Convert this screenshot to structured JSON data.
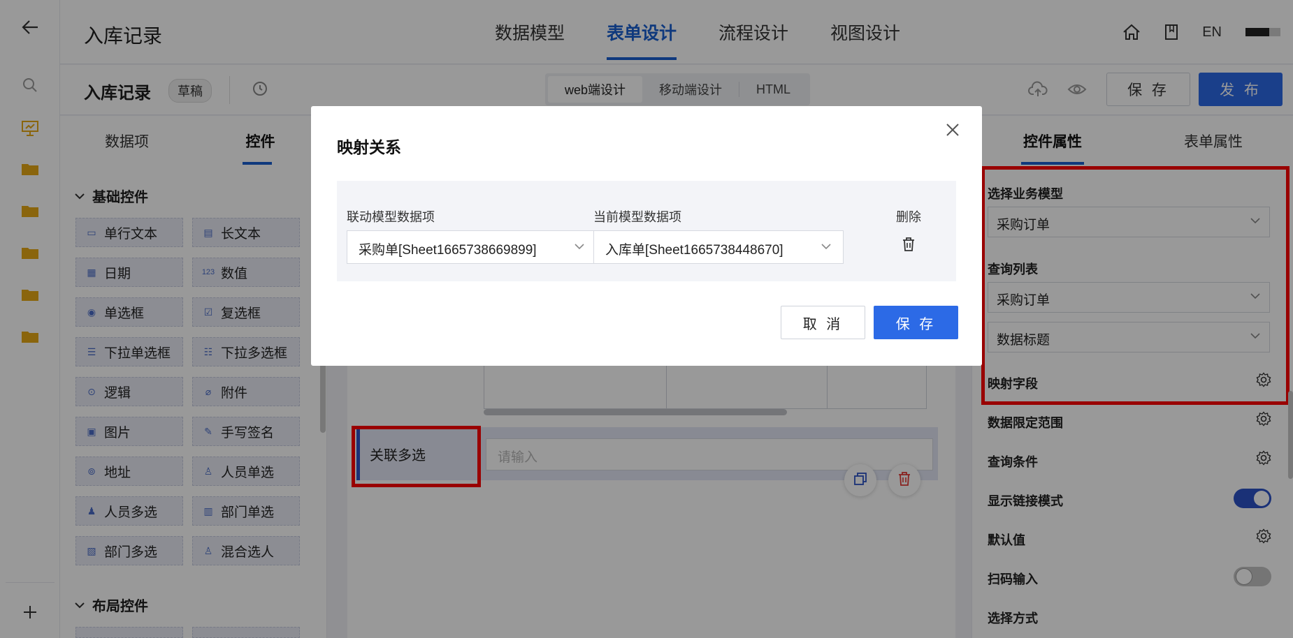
{
  "app": {
    "title": "入库记录"
  },
  "nav": {
    "tabs": [
      {
        "label": "数据模型"
      },
      {
        "label": "表单设计"
      },
      {
        "label": "流程设计"
      },
      {
        "label": "视图设计"
      }
    ],
    "active": 1
  },
  "topbar": {
    "lang": "EN"
  },
  "subbar": {
    "form_title": "入库记录",
    "status_badge": "草稿",
    "modes": [
      "web端设计",
      "移动端设计",
      "HTML"
    ],
    "save_label": "保 存",
    "publish_label": "发 布"
  },
  "left_panel": {
    "tabs": [
      "数据项",
      "控件"
    ],
    "basic_section": "基础控件",
    "basic_controls": [
      {
        "label": "单行文本",
        "icon": "text-line-icon"
      },
      {
        "label": "长文本",
        "icon": "textarea-icon"
      },
      {
        "label": "日期",
        "icon": "calendar-icon"
      },
      {
        "label": "数值",
        "icon": "number-icon"
      },
      {
        "label": "单选框",
        "icon": "radio-icon"
      },
      {
        "label": "复选框",
        "icon": "checkbox-icon"
      },
      {
        "label": "下拉单选框",
        "icon": "list-icon"
      },
      {
        "label": "下拉多选框",
        "icon": "checklist-icon"
      },
      {
        "label": "逻辑",
        "icon": "toggle-icon"
      },
      {
        "label": "附件",
        "icon": "paperclip-icon"
      },
      {
        "label": "图片",
        "icon": "image-icon"
      },
      {
        "label": "手写签名",
        "icon": "pen-icon"
      },
      {
        "label": "地址",
        "icon": "location-pin-icon"
      },
      {
        "label": "人员单选",
        "icon": "user-icon"
      },
      {
        "label": "人员多选",
        "icon": "users-icon"
      },
      {
        "label": "部门单选",
        "icon": "department-icon"
      },
      {
        "label": "部门多选",
        "icon": "departments-icon"
      },
      {
        "label": "混合选人",
        "icon": "user-mixed-icon"
      }
    ],
    "layout_section": "布局控件"
  },
  "canvas": {
    "field_label": "关联多选",
    "field_placeholder": "请输入"
  },
  "right_panel": {
    "tabs": [
      "控件属性",
      "表单属性"
    ],
    "business_model_label": "选择业务模型",
    "business_model_value": "采购订单",
    "query_list_label": "查询列表",
    "query_list_value": "采购订单",
    "data_title_value": "数据标题",
    "mapping_label": "映射字段",
    "data_range_label": "数据限定范围",
    "query_condition_label": "查询条件",
    "link_mode_label": "显示链接模式",
    "link_mode_on": true,
    "default_value_label": "默认值",
    "scan_input_label": "扫码输入",
    "scan_input_on": false,
    "select_mode_label": "选择方式"
  },
  "modal": {
    "title": "映射关系",
    "col_source": "联动模型数据项",
    "col_target": "当前模型数据项",
    "col_delete": "删除",
    "source_value": "采购单[Sheet1665738669899]",
    "target_value": "入库单[Sheet1665738448670]",
    "cancel_label": "取 消",
    "ok_label": "保 存"
  },
  "colors": {
    "accent": "#2c6ae6",
    "highlight": "#ff0000",
    "overlay": "rgba(0,0,0,0.40)"
  }
}
